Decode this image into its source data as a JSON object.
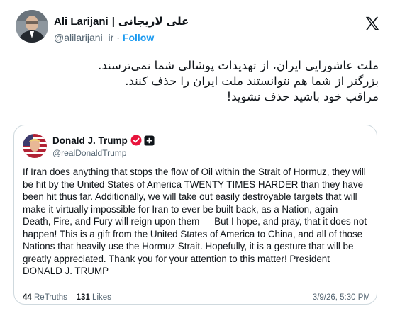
{
  "post": {
    "author_name": "Ali Larijani",
    "author_name_fa": "علی لاریجانی",
    "name_separator": "|",
    "handle": "@alilarijani_ir",
    "separator_dot": "·",
    "follow_label": "Follow",
    "text_lines": [
      "ملت عاشورایی ایران، از تهدیدات پوشالی شما نمی‌ترسند.",
      "بزرگتر از شما هم نتوانستند ملت ایران را حذف کنند.",
      "مراقب خود باشید حذف نشوید!"
    ],
    "platform_icon": "x-logo-icon"
  },
  "quote": {
    "author_name": "Donald J. Trump",
    "handle": "@realDonaldTrump",
    "verified_icon": "verified-badge-icon",
    "affiliation_icon": "plus-badge-icon",
    "body": "If Iran does anything that stops the flow of Oil within the Strait of Hormuz, they will be hit by the United States of America TWENTY TIMES HARDER than they have been hit thus far. Additionally, we will take out easily destroyable targets that will make it virtually impossible for Iran to ever be built back, as a Nation, again — Death, Fire, and Fury will reign upon them — But I hope, and pray, that it does not happen! This is a gift from the United States of America to China, and all of those Nations that heavily use the Hormuz Strait. Hopefully, it is a gesture that will be greatly appreciated. Thank you for your attention to this matter! President DONALD J. TRUMP",
    "retruths_count": "44",
    "retruths_label": "ReTruths",
    "likes_count": "131",
    "likes_label": "Likes",
    "timestamp": "3/9/26, 5:30 PM"
  },
  "colors": {
    "link_blue": "#1d9bf0",
    "secondary_text": "#536471",
    "border": "#cfd9de",
    "verified_red": "#e8143c"
  }
}
